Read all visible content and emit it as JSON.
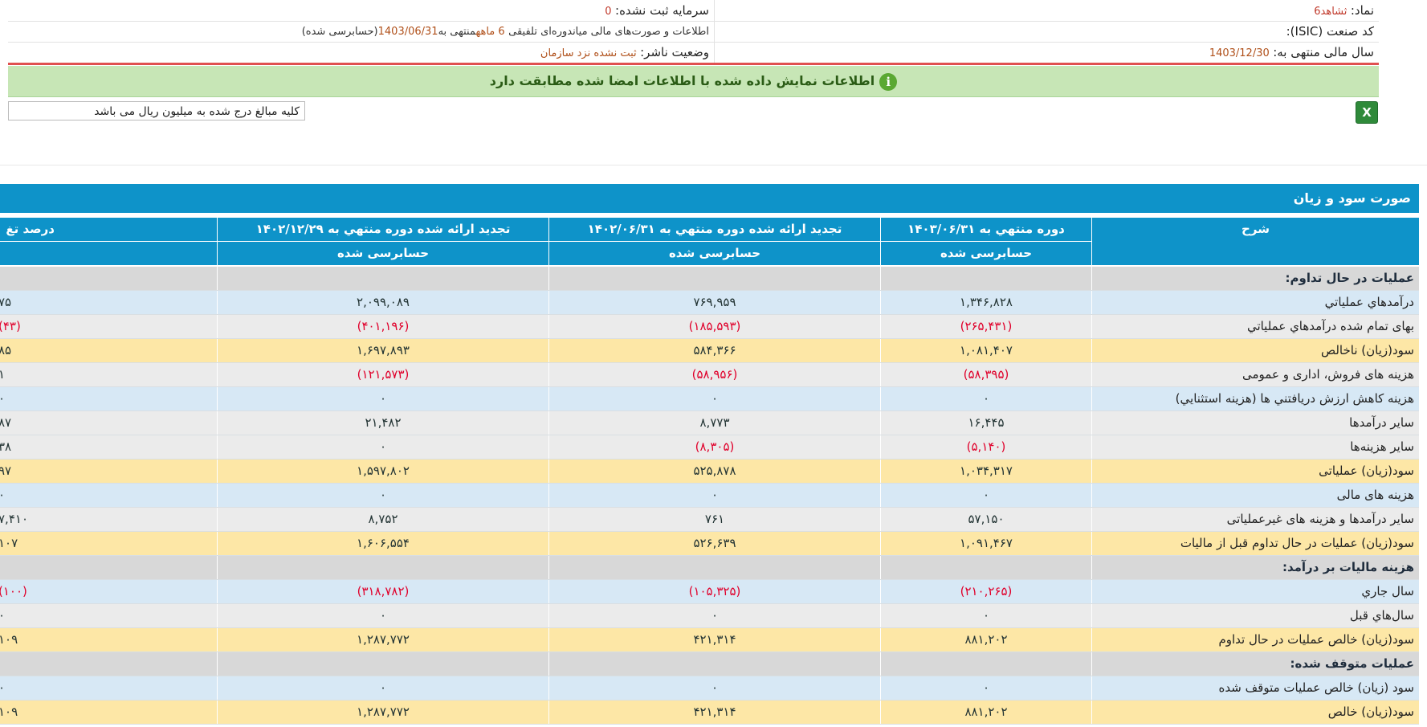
{
  "header": {
    "symbol_label": "نماد:",
    "symbol_value": "ثشاهد6",
    "unregistered_capital_label": "سرمایه ثبت نشده:",
    "unregistered_capital_value": "0",
    "isic_label": "کد صنعت (ISIC):",
    "report_desc_prefix": "اطلاعات و صورت‌های مالی میاندوره‌ای تلفیقی",
    "report_period": "6 ماهه",
    "report_desc_mid": "منتهی به",
    "report_date": "1403/06/31",
    "report_desc_suffix": "(حسابرسی شده)",
    "fiscal_year_label": "سال مالی منتهی به:",
    "fiscal_year_value": "1403/12/30",
    "publisher_status_label": "وضعیت ناشر:",
    "publisher_status_value": "ثبت نشده نزد سازمان"
  },
  "info_bar": {
    "icon": "info-icon",
    "text": "اطلاعات نمایش داده شده با اطلاعات امضا شده مطابقت دارد"
  },
  "note": "کلیه مبالغ درج شده به میلیون ریال می باشد",
  "excel_icon": "excel-icon",
  "section_title": "صورت سود و زیان",
  "table": {
    "col_desc": "شرح",
    "col1_title": "دوره منتهي به ۱۴۰۳/۰۶/۳۱",
    "col1_sub": "حسابرسی شده",
    "col2_title": "تجدید ارائه شده دوره منتهي به ۱۴۰۲/۰۶/۳۱",
    "col2_sub": "حسابرسی شده",
    "col3_title": "تجدید ارائه شده دوره منتهي به ۱۴۰۲/۱۲/۲۹",
    "col3_sub": "حسابرسی شده",
    "col4_title": "درصد تغ",
    "rows": [
      {
        "style": "sec",
        "desc": "عملیات در حال تداوم:",
        "v1": "",
        "v2": "",
        "v3": "",
        "v4": ""
      },
      {
        "style": "blue",
        "desc": "درآمدهاي عملياتي",
        "v1": "۱,۳۴۶,۸۲۸",
        "v2": "۷۶۹,۹۵۹",
        "v3": "۲,۰۹۹,۰۸۹",
        "v4": "۷۵"
      },
      {
        "style": "gray",
        "desc": "بهاى تمام شده درآمدهاي عملياتي",
        "v1": "(۲۶۵,۴۳۱)",
        "v2": "(۱۸۵,۵۹۳)",
        "v3": "(۴۰۱,۱۹۶)",
        "v4": "(۴۳)",
        "neg": true
      },
      {
        "style": "yel",
        "desc": "سود(زيان) ناخالص",
        "v1": "۱,۰۸۱,۴۰۷",
        "v2": "۵۸۴,۳۶۶",
        "v3": "۱,۶۹۷,۸۹۳",
        "v4": "۸۵"
      },
      {
        "style": "gray",
        "desc": "هزینه های فروش، اداری و عمومی",
        "v1": "(۵۸,۳۹۵)",
        "v2": "(۵۸,۹۵۶)",
        "v3": "(۱۲۱,۵۷۳)",
        "v4": "۱",
        "neg": true,
        "neg4": false
      },
      {
        "style": "blue",
        "desc": "هزینه کاهش ارزش دریافتني ها (هزينه استثنايي)",
        "v1": "۰",
        "v2": "۰",
        "v3": "۰",
        "v4": "۰"
      },
      {
        "style": "gray",
        "desc": "ساير درآمدها",
        "v1": "۱۶,۴۴۵",
        "v2": "۸,۷۷۳",
        "v3": "۲۱,۴۸۲",
        "v4": "۸۷"
      },
      {
        "style": "gray",
        "desc": "سایر هزینه‌ها",
        "v1": "(۵,۱۴۰)",
        "v2": "(۸,۳۰۵)",
        "v3": "۰",
        "v4": "۳۸",
        "neg12": true
      },
      {
        "style": "yel",
        "desc": "سود(زيان) عملياتى",
        "v1": "۱,۰۳۴,۳۱۷",
        "v2": "۵۲۵,۸۷۸",
        "v3": "۱,۵۹۷,۸۰۲",
        "v4": "۹۷"
      },
      {
        "style": "blue",
        "desc": "هزينه هاى مالى",
        "v1": "۰",
        "v2": "۰",
        "v3": "۰",
        "v4": "۰"
      },
      {
        "style": "gray",
        "desc": "ساير درآمدها و هزينه هاى غيرعملياتى",
        "v1": "۵۷,۱۵۰",
        "v2": "۷۶۱",
        "v3": "۸,۷۵۲",
        "v4": "۷,۴۱۰"
      },
      {
        "style": "yel",
        "desc": "سود(زيان) عمليات در حال تداوم قبل از ماليات",
        "v1": "۱,۰۹۱,۴۶۷",
        "v2": "۵۲۶,۶۳۹",
        "v3": "۱,۶۰۶,۵۵۴",
        "v4": "۱۰۷"
      },
      {
        "style": "sec",
        "desc": "هزينه ماليات بر درآمد:",
        "v1": "",
        "v2": "",
        "v3": "",
        "v4": ""
      },
      {
        "style": "blue",
        "desc": "سال جاري",
        "v1": "(۲۱۰,۲۶۵)",
        "v2": "(۱۰۵,۳۲۵)",
        "v3": "(۳۱۸,۷۸۲)",
        "v4": "(۱۰۰)",
        "neg": true
      },
      {
        "style": "gray",
        "desc": "سال‌هاي قبل",
        "v1": "۰",
        "v2": "۰",
        "v3": "۰",
        "v4": "۰"
      },
      {
        "style": "yel",
        "desc": "سود(زيان) خالص عمليات در حال تداوم",
        "v1": "۸۸۱,۲۰۲",
        "v2": "۴۲۱,۳۱۴",
        "v3": "۱,۲۸۷,۷۷۲",
        "v4": "۱۰۹"
      },
      {
        "style": "sec",
        "desc": "عملیات متوقف شده:",
        "v1": "",
        "v2": "",
        "v3": "",
        "v4": ""
      },
      {
        "style": "blue",
        "desc": "سود (زيان) خالص عمليات متوقف شده",
        "v1": "۰",
        "v2": "۰",
        "v3": "۰",
        "v4": "۰"
      },
      {
        "style": "yel",
        "desc": "سود(زيان) خالص",
        "v1": "۸۸۱,۲۰۲",
        "v2": "۴۲۱,۳۱۴",
        "v3": "۱,۲۸۷,۷۷۲",
        "v4": "۱۰۹"
      }
    ]
  }
}
